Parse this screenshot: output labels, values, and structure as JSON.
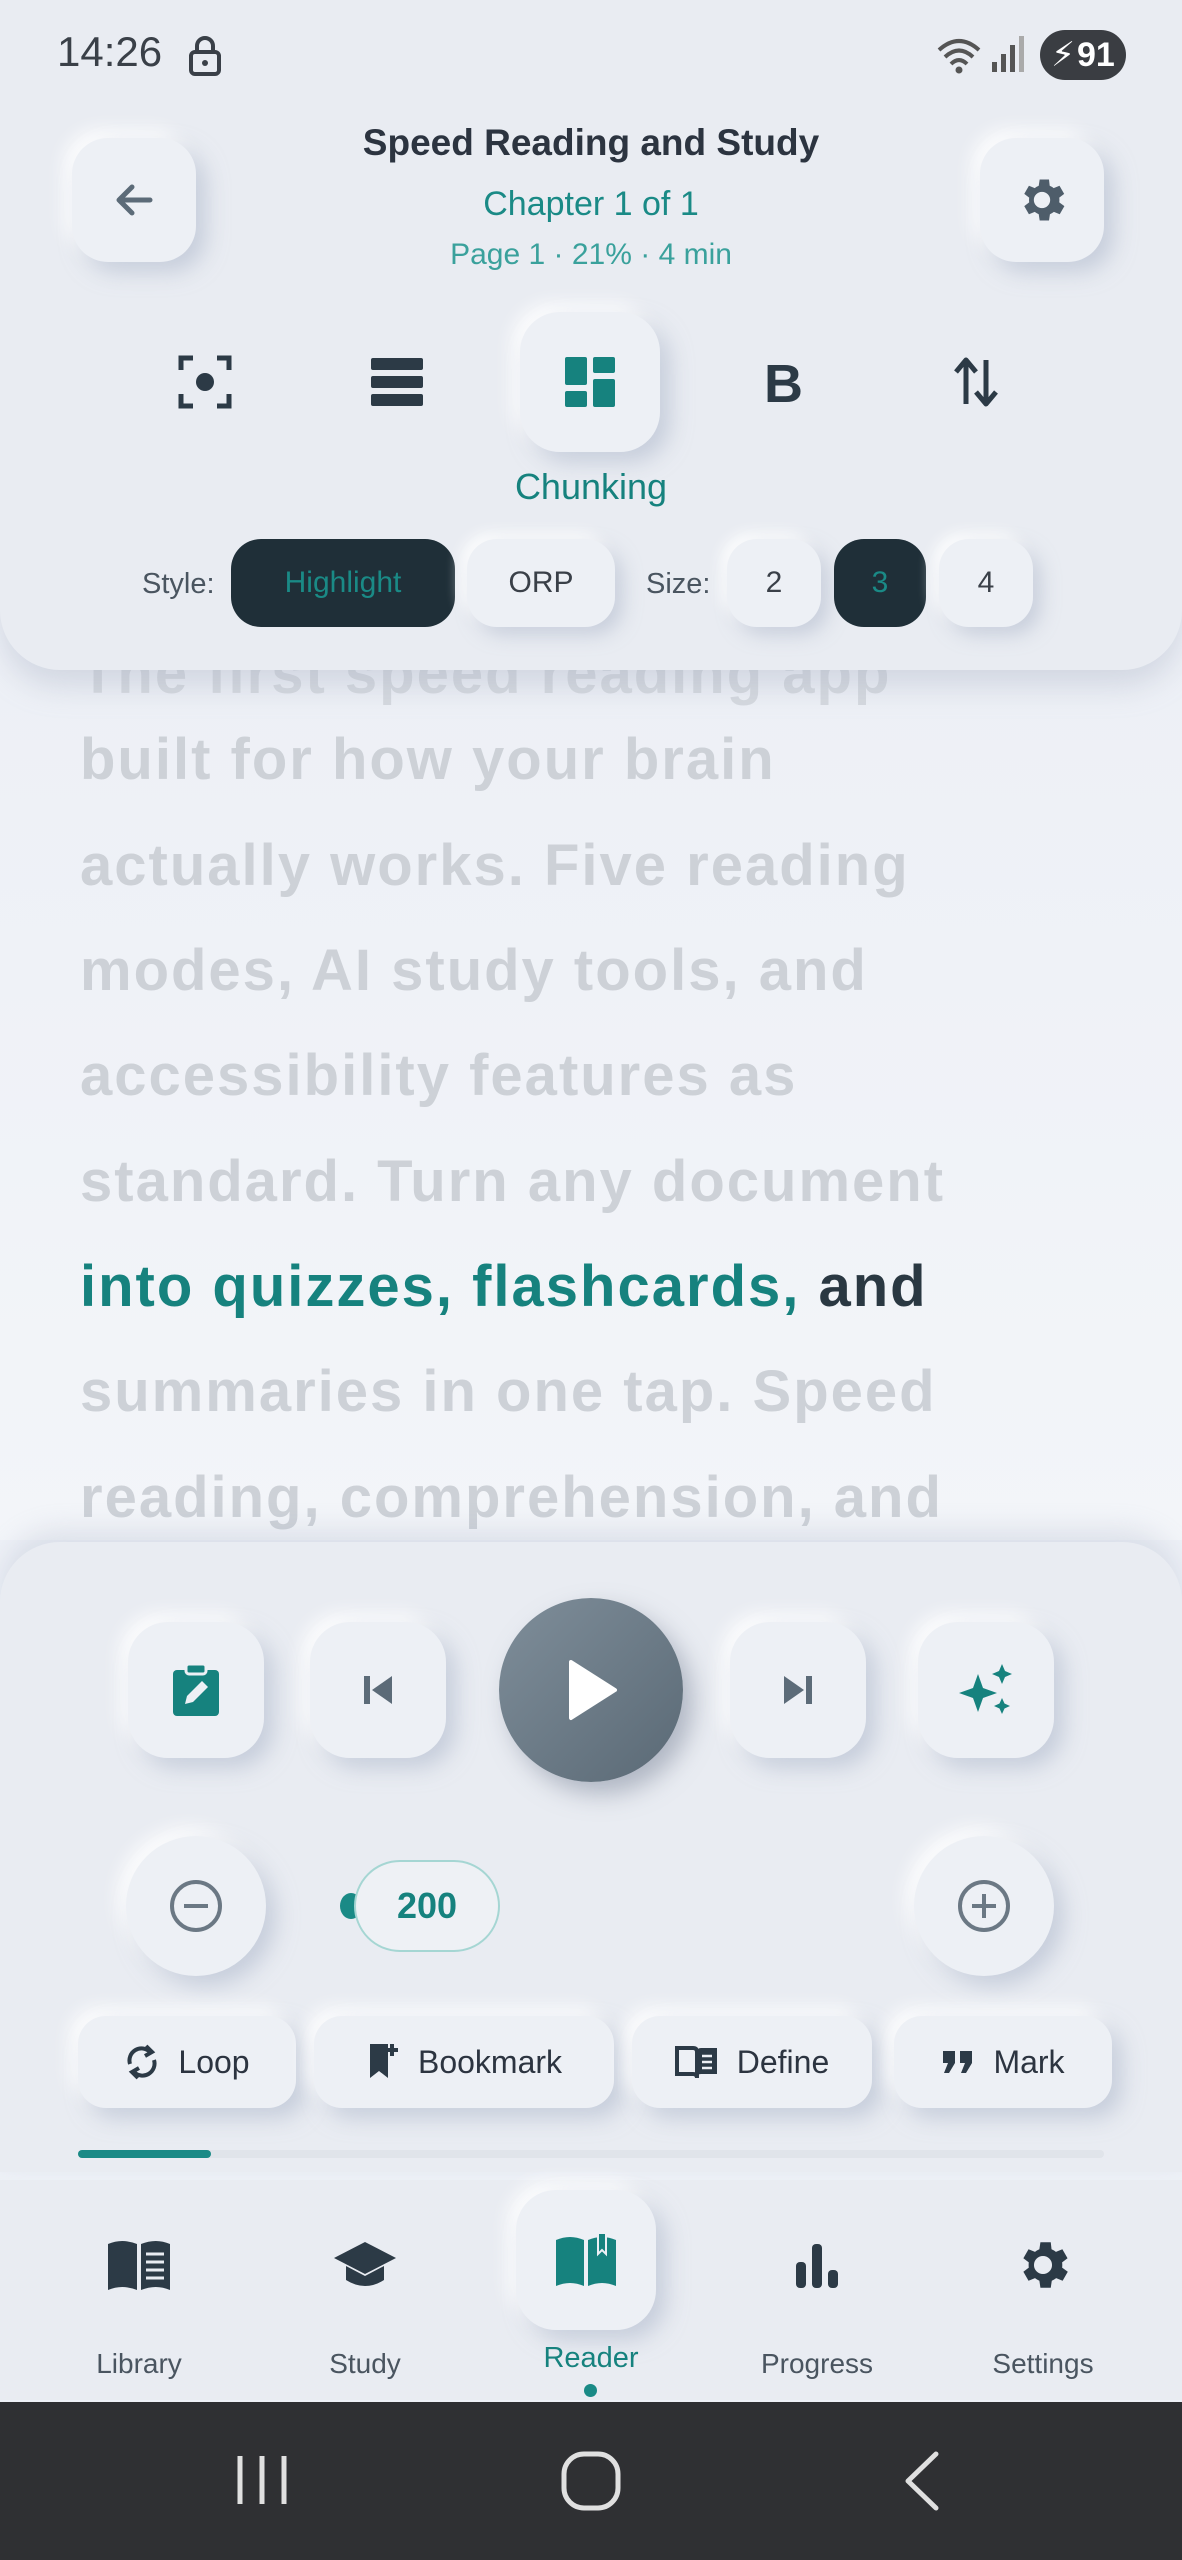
{
  "status": {
    "time": "14:26",
    "battery": "91"
  },
  "header": {
    "title": "Speed Reading and Study",
    "chapter": "Chapter 1 of 1",
    "page": "Page 1",
    "percent": "21%",
    "time_left": "4 min",
    "separator": "·",
    "active_mode_label": "Chunking",
    "modes": [
      "focus",
      "lines",
      "chunking",
      "bold",
      "scroll"
    ]
  },
  "options": {
    "style_label": "Style:",
    "style_options": [
      "Highlight",
      "ORP"
    ],
    "style_selected": "Highlight",
    "size_label": "Size:",
    "size_options": [
      "2",
      "3",
      "4"
    ],
    "size_selected": "3"
  },
  "reading": {
    "top_partial": "The first speed reading app",
    "lines": [
      "built for how your brain",
      "actually works. Five reading",
      "modes, AI study tools, and",
      "accessibility features as",
      "standard. Turn any document"
    ],
    "highlight_chunk": "into quizzes, flashcards,",
    "current_word": "and",
    "lines_after": [
      "summaries in one tap. Speed",
      "reading, comprehension, and"
    ]
  },
  "controls": {
    "wpm": "200",
    "chips": [
      "Loop",
      "Bookmark",
      "Define",
      "Mark"
    ],
    "progress": 0.13
  },
  "nav": {
    "items": [
      "Library",
      "Study",
      "Reader",
      "Progress",
      "Settings"
    ],
    "active": "Reader"
  },
  "colors": {
    "accent": "#1a8a86",
    "dark": "#1f2f38",
    "background": "#eef1f7"
  }
}
